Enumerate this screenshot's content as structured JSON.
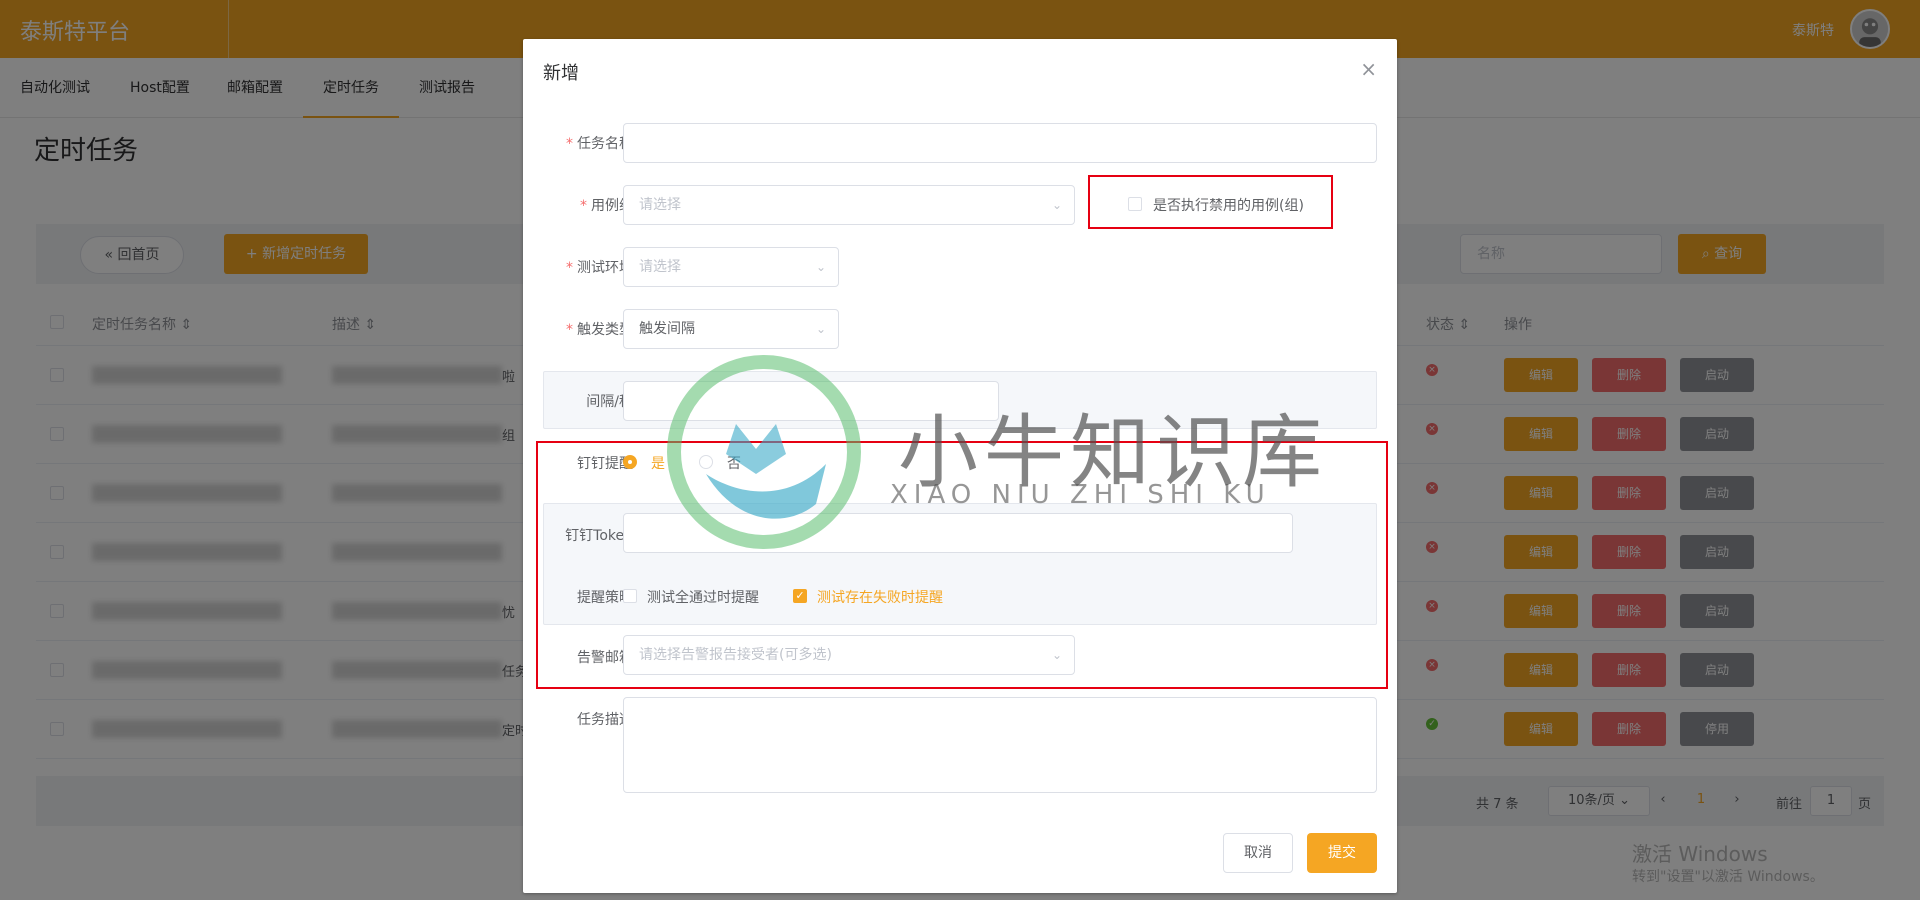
{
  "app": {
    "title": "泰斯特平台",
    "user": "泰斯特"
  },
  "nav": [
    "自动化测试",
    "Host配置",
    "邮箱配置",
    "定时任务",
    "测试报告"
  ],
  "page": {
    "title": "定时任务"
  },
  "toolbar": {
    "home_label": "回首页",
    "add_label": "新增定时任务",
    "search_placeholder": "名称",
    "query_label": "查询"
  },
  "table": {
    "headers": {
      "name": "定时任务名称",
      "desc": "描述",
      "status": "状态",
      "ops": "操作"
    },
    "rows": [
      {
        "desc_tail": "啦",
        "ok": false,
        "run_label": "启动"
      },
      {
        "desc_tail": "组",
        "ok": false,
        "run_label": "启动"
      },
      {
        "desc_tail": "",
        "ok": false,
        "run_label": "启动"
      },
      {
        "desc_tail": "",
        "ok": false,
        "run_label": "启动"
      },
      {
        "desc_tail": "忧",
        "ok": false,
        "run_label": "启动"
      },
      {
        "desc_tail": "任务",
        "ok": false,
        "run_label": "启动"
      },
      {
        "desc_tail": "定时",
        "ok": true,
        "run_label": "停用"
      }
    ],
    "edit_label": "编辑",
    "delete_label": "删除"
  },
  "pager": {
    "total": "共 7 条",
    "page_size": "10条/页",
    "current": "1",
    "goto_label": "前往",
    "goto_value": "1",
    "page_unit": "页"
  },
  "os_watermark": {
    "line1": "激活 Windows",
    "line2": "转到\"设置\"以激活 Windows。"
  },
  "dialog": {
    "title": "新增",
    "fields": {
      "task_name": {
        "label": "任务名称",
        "value": ""
      },
      "case_group": {
        "label": "用例组",
        "placeholder": "请选择"
      },
      "disabled_cases": {
        "label": "是否执行禁用的用例(组)",
        "checked": false
      },
      "env": {
        "label": "测试环境",
        "placeholder": "请选择"
      },
      "trigger": {
        "label": "触发类型",
        "value": "触发间隔"
      },
      "interval": {
        "label": "间隔/秒",
        "value": ""
      },
      "dingtalk": {
        "label": "钉钉提醒",
        "yes": "是",
        "no": "否",
        "selected": "是"
      },
      "token": {
        "label": "钉钉Token",
        "value": ""
      },
      "strategy": {
        "label": "提醒策略",
        "opt_all_pass": "测试全通过时提醒",
        "opt_has_fail": "测试存在失败时提醒",
        "all_pass_checked": false,
        "has_fail_checked": true
      },
      "alert_mail": {
        "label": "告警邮箱",
        "placeholder": "请选择告警报告接受者(可多选)"
      },
      "description": {
        "label": "任务描述",
        "value": ""
      }
    },
    "cancel_label": "取消",
    "submit_label": "提交"
  },
  "watermark": {
    "name": "小牛知识库",
    "sub": "XIAO NIU ZHI SHI KU"
  },
  "colors": {
    "primary": "#f5a623",
    "danger": "#f56c6c",
    "info": "#909399",
    "success": "#67c23a",
    "highlight": "#e60012"
  }
}
